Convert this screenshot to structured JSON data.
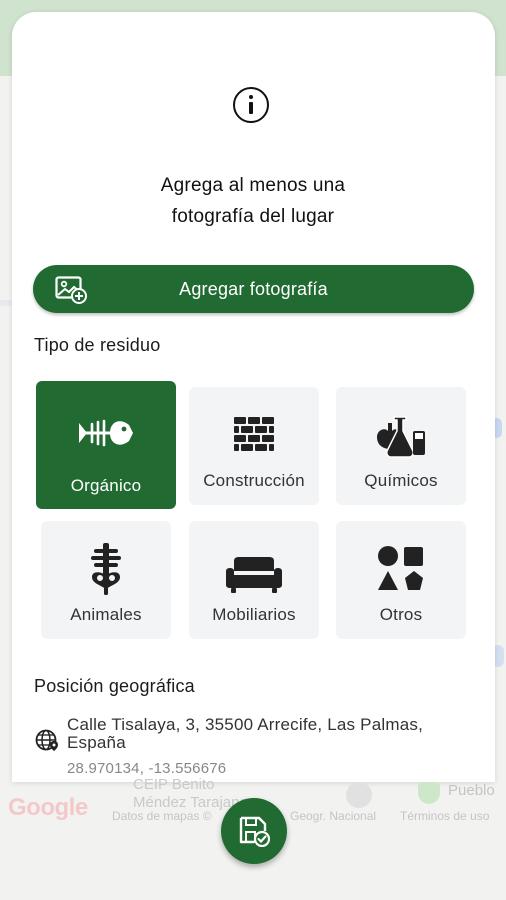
{
  "dialog": {
    "prompt_line1": "Agrega al menos una",
    "prompt_line2": "fotografía del lugar",
    "add_photo_label": "Agregar fotografía"
  },
  "waste_type": {
    "title": "Tipo de residuo",
    "selected": "Orgánico",
    "options": [
      {
        "label": "Orgánico",
        "icon": "fish-bone-icon"
      },
      {
        "label": "Construcción",
        "icon": "brick-wall-icon"
      },
      {
        "label": "Químicos",
        "icon": "chemistry-flask-icon"
      },
      {
        "label": "Animales",
        "icon": "skeleton-icon"
      },
      {
        "label": "Mobiliarios",
        "icon": "sofa-icon"
      },
      {
        "label": "Otros",
        "icon": "shapes-icon"
      }
    ]
  },
  "location": {
    "title": "Posición geográfica",
    "address": "Calle Tisalaya, 3, 35500 Arrecife, Las Palmas, España",
    "coordinates": "28.970134, -13.556676"
  },
  "map": {
    "logo": "Google",
    "poi_line1": "CEIP Benito",
    "poi_line2": "Méndez Tarajano",
    "credit_data": "Datos de mapas ©",
    "credit_geo": "Geogr. Nacional",
    "credit_terms": "Términos de uso",
    "poi_right": "Pueblo"
  },
  "colors": {
    "primary": "#216b32",
    "tile_bg": "#f3f4f5"
  }
}
